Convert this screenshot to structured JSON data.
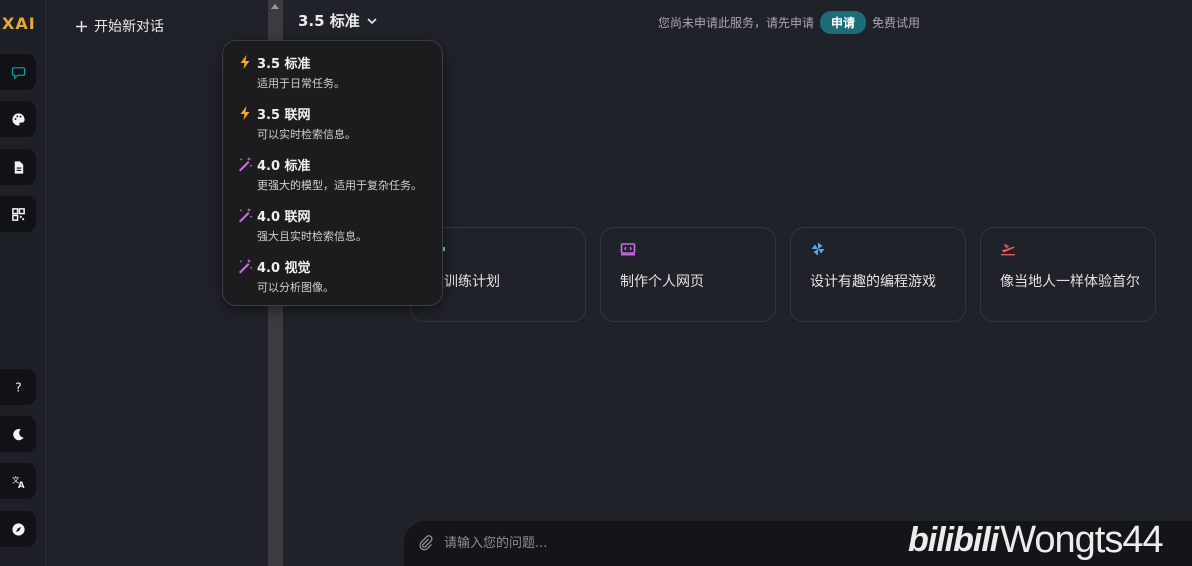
{
  "app": {
    "logo_text": "XAI"
  },
  "rail": {
    "items": [
      {
        "name": "chat-icon",
        "active": true
      },
      {
        "name": "palette-icon"
      },
      {
        "name": "document-icon"
      },
      {
        "name": "apps-icon"
      },
      {
        "name": "help-icon"
      },
      {
        "name": "moon-icon"
      },
      {
        "name": "translate-icon"
      },
      {
        "name": "compass-icon"
      }
    ]
  },
  "sidebar": {
    "new_chat_label": "开始新对话"
  },
  "header": {
    "model_label": "3.5 标准",
    "notice_text": "您尚未申请此服务，请先申请",
    "apply_label": "申请",
    "trial_text": "免费试用"
  },
  "model_menu": {
    "options": [
      {
        "title": "3.5 标准",
        "desc": "适用于日常任务。",
        "icon": "bolt-icon"
      },
      {
        "title": "3.5 联网",
        "desc": "可以实时检索信息。",
        "icon": "bolt-icon"
      },
      {
        "title": "4.0 标准",
        "desc": "更强大的模型，适用于复杂任务。",
        "icon": "magic-wand-icon"
      },
      {
        "title": "4.0 联网",
        "desc": "强大且实时检索信息。",
        "icon": "magic-wand-icon"
      },
      {
        "title": "4.0 视觉",
        "desc": "可以分析图像。",
        "icon": "magic-wand-icon"
      }
    ]
  },
  "suggestions": [
    {
      "label": "建训练计划",
      "icon": "dumbbell-icon"
    },
    {
      "label": "制作个人网页",
      "icon": "code-window-icon"
    },
    {
      "label": "设计有趣的编程游戏",
      "icon": "pinwheel-icon"
    },
    {
      "label": "像当地人一样体验首尔",
      "icon": "airplane-icon"
    }
  ],
  "composer": {
    "placeholder": "请输入您的问题..."
  },
  "watermark": {
    "brand": "bilibili",
    "user": "Wongts44"
  },
  "colors": {
    "accent": "#1d6c7a",
    "bolt": "#f5a623",
    "wand": "#c86ee0",
    "code_icon": "#c86ee0",
    "pinwheel": "#5aa6e6",
    "airplane": "#e25a5a"
  }
}
